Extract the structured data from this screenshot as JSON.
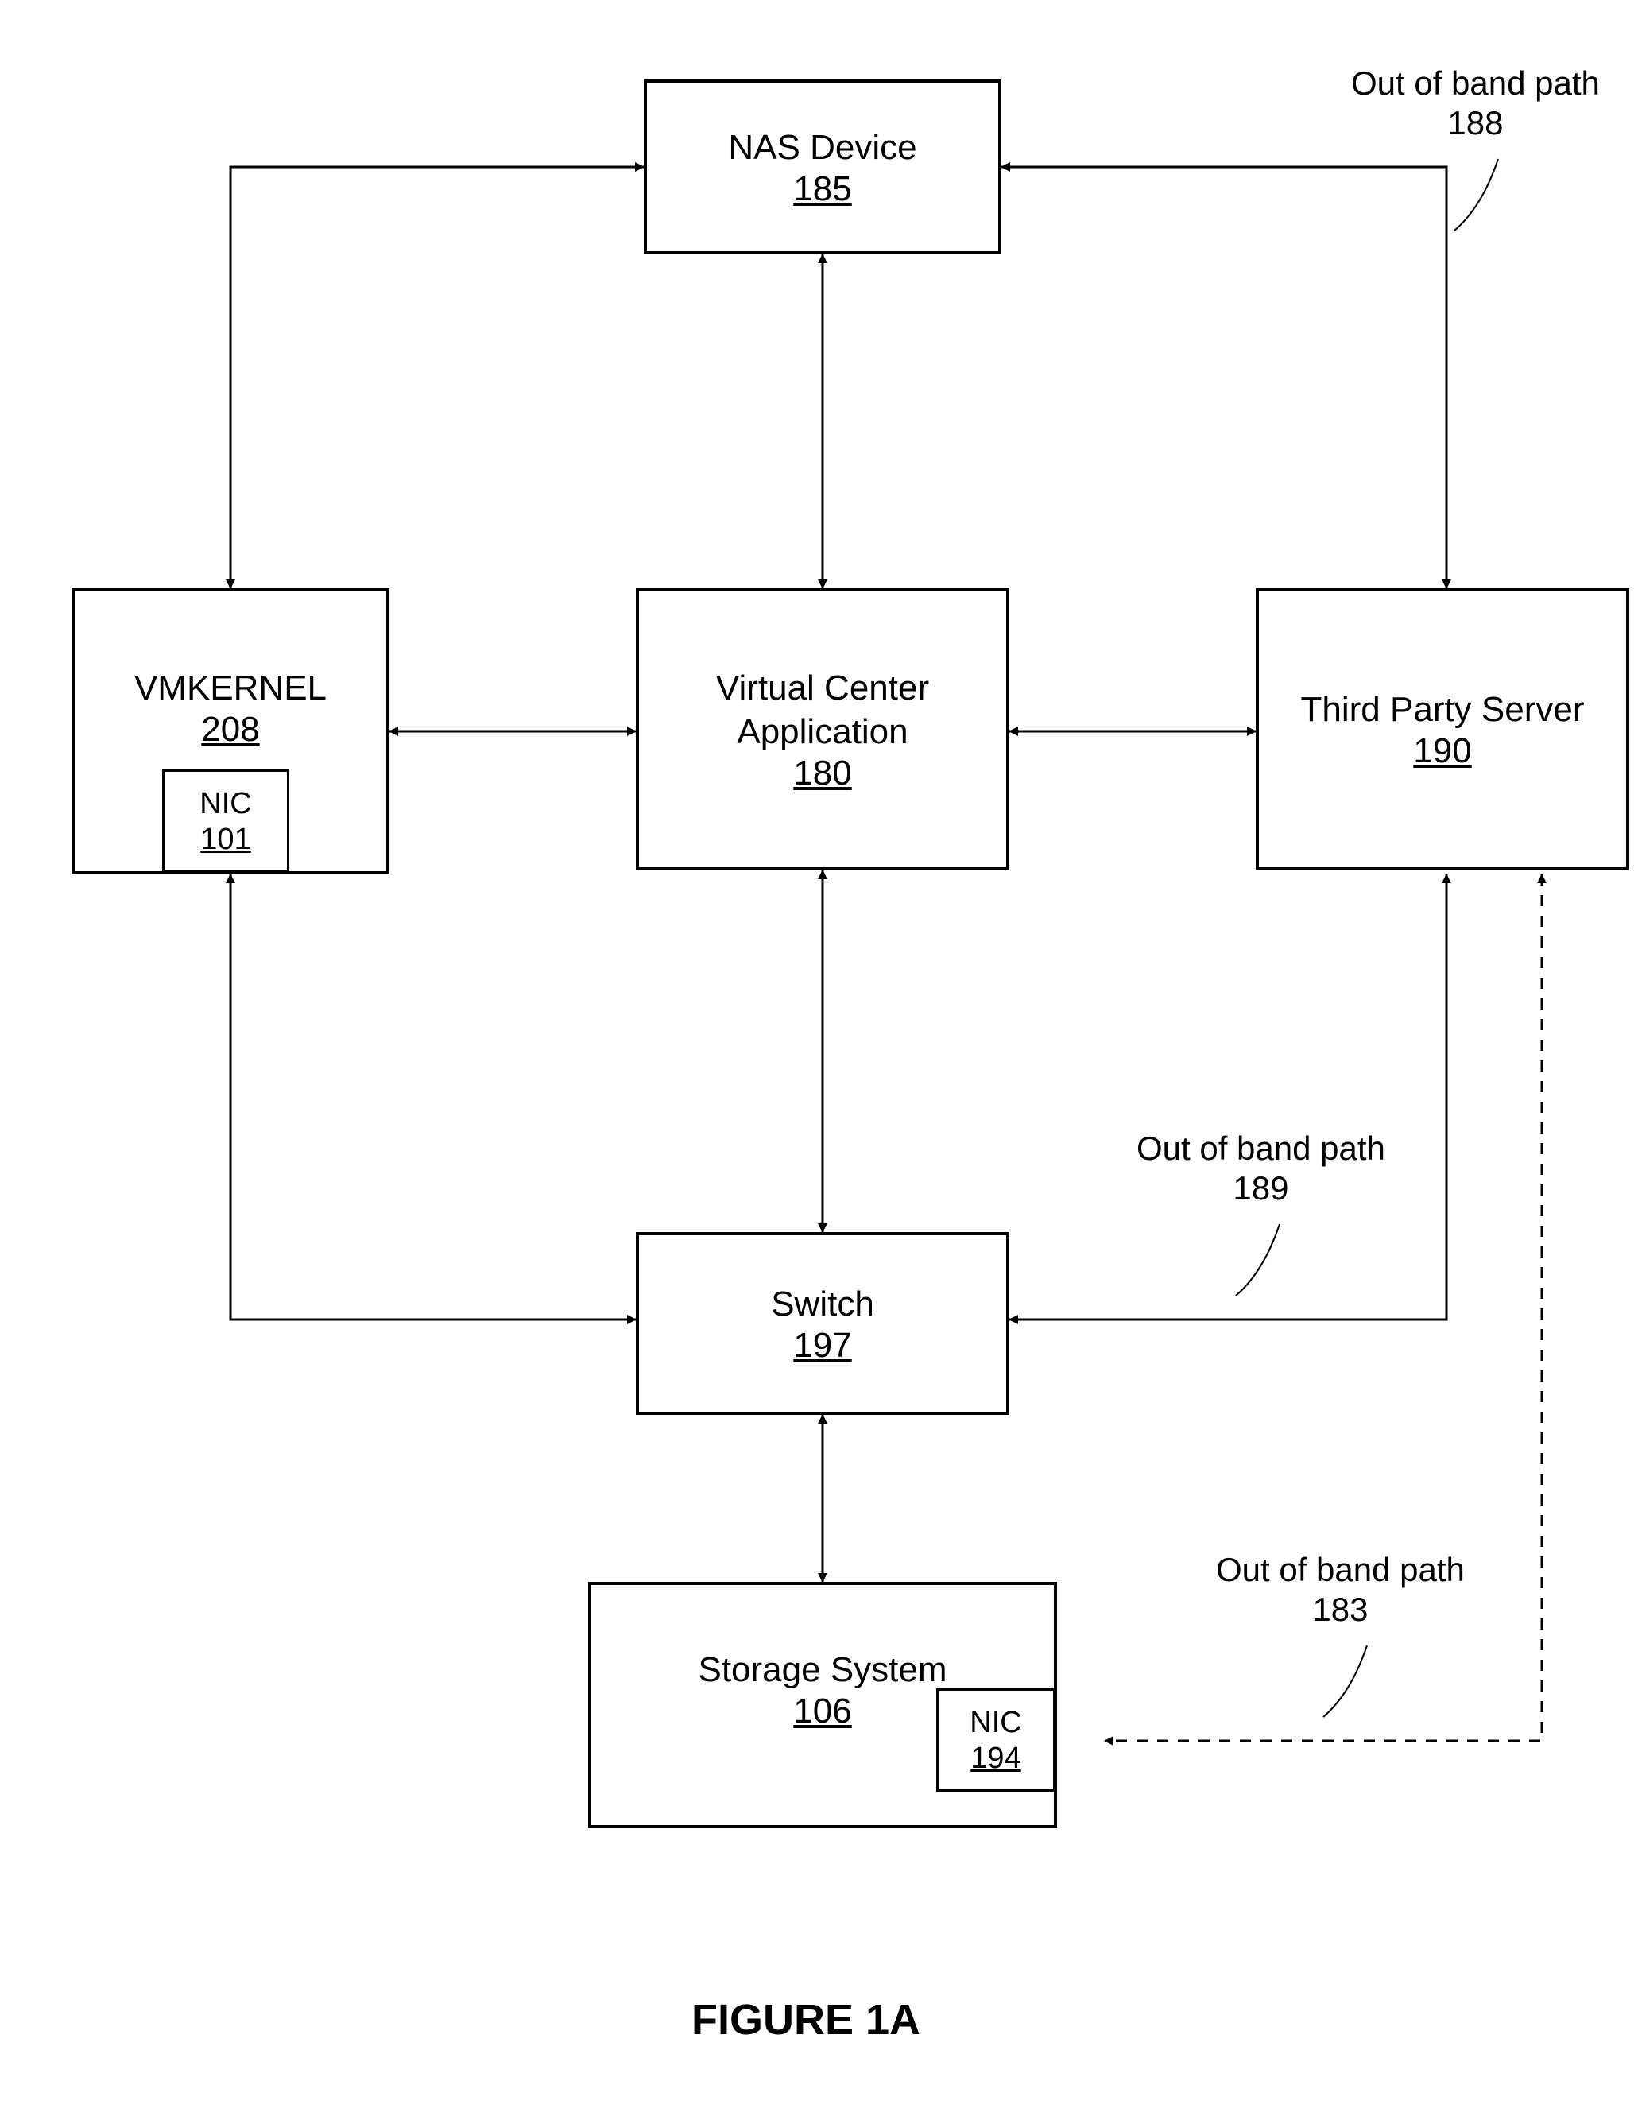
{
  "boxes": {
    "nas": {
      "title": "NAS Device",
      "num": "185"
    },
    "vmk": {
      "title": "VMKERNEL",
      "num": "208"
    },
    "nic_vmk": {
      "title": "NIC",
      "num": "101"
    },
    "vca": {
      "title": "Virtual Center\nApplication",
      "num": "180"
    },
    "tps": {
      "title": "Third Party Server",
      "num": "190"
    },
    "switch": {
      "title": "Switch",
      "num": "197"
    },
    "storage": {
      "title": "Storage System",
      "num": "106"
    },
    "nic_stor": {
      "title": "NIC",
      "num": "194"
    }
  },
  "edge_labels": {
    "oob188": {
      "text": "Out of band path",
      "num": "188"
    },
    "oob189": {
      "text": "Out of band path",
      "num": "189"
    },
    "oob183": {
      "text": "Out of band path",
      "num": "183"
    }
  },
  "figure_title": "FIGURE 1A",
  "diagram": {
    "nodes": [
      {
        "id": "nas",
        "label": "NAS Device",
        "ref": "185"
      },
      {
        "id": "vmk",
        "label": "VMKERNEL",
        "ref": "208",
        "contains": [
          {
            "id": "nic_vmk",
            "label": "NIC",
            "ref": "101"
          }
        ]
      },
      {
        "id": "vca",
        "label": "Virtual Center Application",
        "ref": "180"
      },
      {
        "id": "tps",
        "label": "Third Party Server",
        "ref": "190"
      },
      {
        "id": "switch",
        "label": "Switch",
        "ref": "197"
      },
      {
        "id": "storage",
        "label": "Storage System",
        "ref": "106",
        "contains": [
          {
            "id": "nic_stor",
            "label": "NIC",
            "ref": "194"
          }
        ]
      }
    ],
    "edges": [
      {
        "from": "nas",
        "to": "vmk",
        "bidir": true
      },
      {
        "from": "nas",
        "to": "vca",
        "bidir": true
      },
      {
        "from": "nas",
        "to": "tps",
        "bidir": true,
        "label": "Out of band path",
        "ref": "188"
      },
      {
        "from": "vmk",
        "to": "vca",
        "bidir": true
      },
      {
        "from": "vca",
        "to": "tps",
        "bidir": true
      },
      {
        "from": "vca",
        "to": "switch",
        "bidir": true
      },
      {
        "from": "vmk",
        "to": "switch",
        "bidir": true
      },
      {
        "from": "tps",
        "to": "switch",
        "bidir": true,
        "label": "Out of band path",
        "ref": "189"
      },
      {
        "from": "switch",
        "to": "storage",
        "bidir": true
      },
      {
        "from": "tps",
        "to": "nic_stor",
        "bidir": true,
        "style": "dashed",
        "label": "Out of band path",
        "ref": "183"
      }
    ]
  }
}
